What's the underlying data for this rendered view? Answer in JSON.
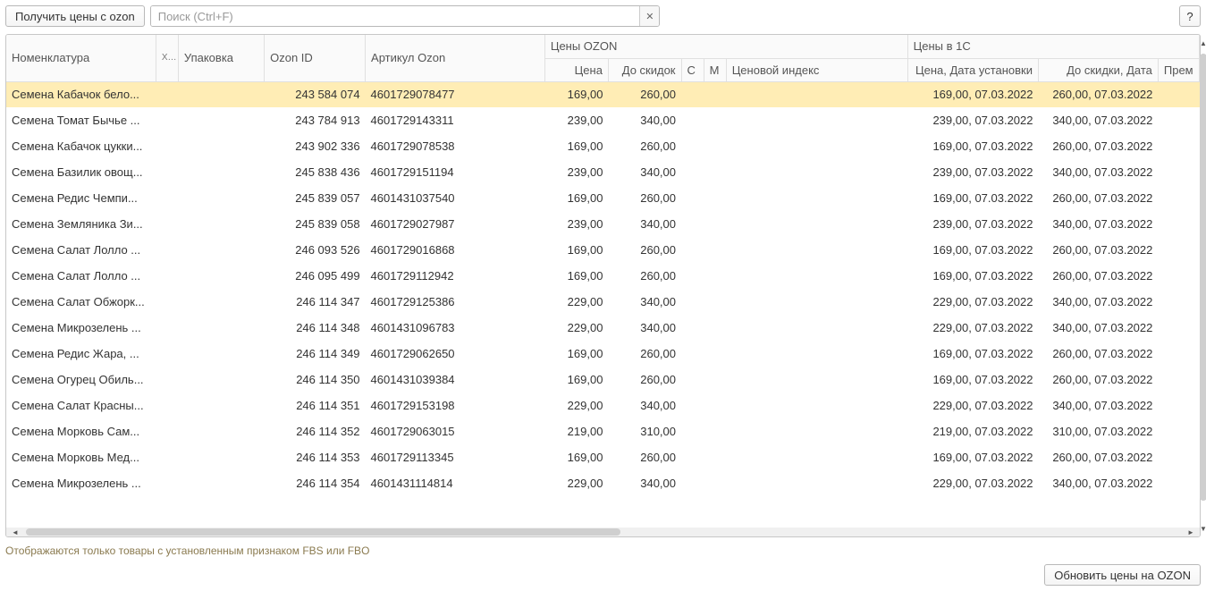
{
  "toolbar": {
    "get_prices_label": "Получить цены с ozon",
    "search_placeholder": "Поиск (Ctrl+F)",
    "search_value": "",
    "clear_label": "✕",
    "help_label": "?"
  },
  "columns": {
    "nomenclature": "Номенклатура",
    "hn": "Х н",
    "package": "Упаковка",
    "ozon_id": "Ozon ID",
    "ozon_article": "Артикул Ozon",
    "ozon_prices_group": "Цены OZON",
    "price": "Цена",
    "before_discount": "До скидок",
    "c": "С",
    "m": "М",
    "price_index": "Ценовой индекс",
    "prices_1c_group": "Цены в 1С",
    "price_date": "Цена, Дата установки",
    "before_discount_date": "До скидки, Дата",
    "prem": "Прем"
  },
  "rows": [
    {
      "name": "Семена Кабачок бело...",
      "ozon_id": "243 584 074",
      "article": "4601729078477",
      "price": "169,00",
      "before": "260,00",
      "price_date": "169,00, 07.03.2022",
      "before_date": "260,00, 07.03.2022",
      "selected": true
    },
    {
      "name": "Семена Томат Бычье ...",
      "ozon_id": "243 784 913",
      "article": "4601729143311",
      "price": "239,00",
      "before": "340,00",
      "price_date": "239,00, 07.03.2022",
      "before_date": "340,00, 07.03.2022"
    },
    {
      "name": "Семена Кабачок цукки...",
      "ozon_id": "243 902 336",
      "article": "4601729078538",
      "price": "169,00",
      "before": "260,00",
      "price_date": "169,00, 07.03.2022",
      "before_date": "260,00, 07.03.2022"
    },
    {
      "name": "Семена Базилик овощ...",
      "ozon_id": "245 838 436",
      "article": "4601729151194",
      "price": "239,00",
      "before": "340,00",
      "price_date": "239,00, 07.03.2022",
      "before_date": "340,00, 07.03.2022"
    },
    {
      "name": "Семена Редис Чемпи...",
      "ozon_id": "245 839 057",
      "article": "4601431037540",
      "price": "169,00",
      "before": "260,00",
      "price_date": "169,00, 07.03.2022",
      "before_date": "260,00, 07.03.2022"
    },
    {
      "name": "Семена Земляника Зи...",
      "ozon_id": "245 839 058",
      "article": "4601729027987",
      "price": "239,00",
      "before": "340,00",
      "price_date": "239,00, 07.03.2022",
      "before_date": "340,00, 07.03.2022"
    },
    {
      "name": "Семена Салат Лолло ...",
      "ozon_id": "246 093 526",
      "article": "4601729016868",
      "price": "169,00",
      "before": "260,00",
      "price_date": "169,00, 07.03.2022",
      "before_date": "260,00, 07.03.2022"
    },
    {
      "name": "Семена Салат Лолло ...",
      "ozon_id": "246 095 499",
      "article": "4601729112942",
      "price": "169,00",
      "before": "260,00",
      "price_date": "169,00, 07.03.2022",
      "before_date": "260,00, 07.03.2022"
    },
    {
      "name": "Семена Салат Обжорк...",
      "ozon_id": "246 114 347",
      "article": "4601729125386",
      "price": "229,00",
      "before": "340,00",
      "price_date": "229,00, 07.03.2022",
      "before_date": "340,00, 07.03.2022"
    },
    {
      "name": "Семена Микрозелень ...",
      "ozon_id": "246 114 348",
      "article": "4601431096783",
      "price": "229,00",
      "before": "340,00",
      "price_date": "229,00, 07.03.2022",
      "before_date": "340,00, 07.03.2022"
    },
    {
      "name": "Семена Редис Жара, ...",
      "ozon_id": "246 114 349",
      "article": "4601729062650",
      "price": "169,00",
      "before": "260,00",
      "price_date": "169,00, 07.03.2022",
      "before_date": "260,00, 07.03.2022"
    },
    {
      "name": "Семена Огурец Обиль...",
      "ozon_id": "246 114 350",
      "article": "4601431039384",
      "price": "169,00",
      "before": "260,00",
      "price_date": "169,00, 07.03.2022",
      "before_date": "260,00, 07.03.2022"
    },
    {
      "name": "Семена Салат Красны...",
      "ozon_id": "246 114 351",
      "article": "4601729153198",
      "price": "229,00",
      "before": "340,00",
      "price_date": "229,00, 07.03.2022",
      "before_date": "340,00, 07.03.2022"
    },
    {
      "name": "Семена Морковь Сам...",
      "ozon_id": "246 114 352",
      "article": "4601729063015",
      "price": "219,00",
      "before": "310,00",
      "price_date": "219,00, 07.03.2022",
      "before_date": "310,00, 07.03.2022"
    },
    {
      "name": "Семена Морковь Мед...",
      "ozon_id": "246 114 353",
      "article": "4601729113345",
      "price": "169,00",
      "before": "260,00",
      "price_date": "169,00, 07.03.2022",
      "before_date": "260,00, 07.03.2022"
    },
    {
      "name": "Семена Микрозелень ...",
      "ozon_id": "246 114 354",
      "article": "4601431114814",
      "price": "229,00",
      "before": "340,00",
      "price_date": "229,00, 07.03.2022",
      "before_date": "340,00, 07.03.2022"
    }
  ],
  "footer": {
    "note": "Отображаются только товары с установленным признаком FBS или FBO",
    "update_button": "Обновить цены на OZON"
  }
}
